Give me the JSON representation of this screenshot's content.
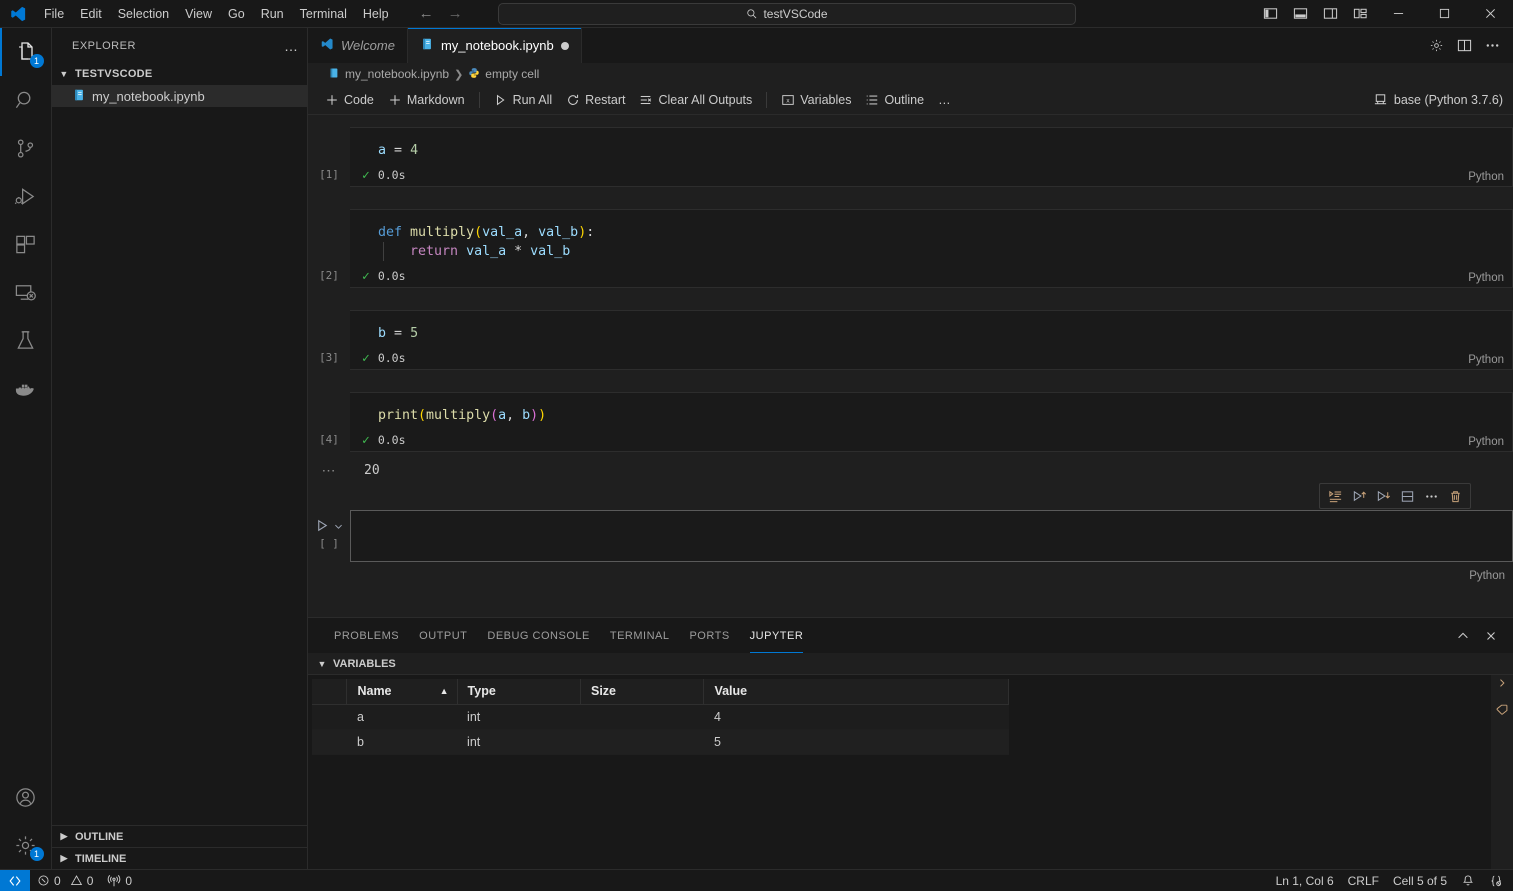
{
  "titlebar": {
    "menus": [
      "File",
      "Edit",
      "Selection",
      "View",
      "Go",
      "Run",
      "Terminal",
      "Help"
    ],
    "search_text": "testVSCode",
    "back_icon": "arrow-left-icon",
    "forward_icon": "arrow-right-icon",
    "layout_icons": [
      "toggle-primary-sidebar-icon",
      "toggle-panel-icon",
      "toggle-secondary-sidebar-icon",
      "customize-layout-icon"
    ],
    "window_controls": [
      "minimize",
      "maximize",
      "close"
    ]
  },
  "activitybar": {
    "items": [
      {
        "name": "explorer",
        "badge": "1",
        "active": true
      },
      {
        "name": "search",
        "badge": "",
        "active": false
      },
      {
        "name": "source-control",
        "badge": "",
        "active": false
      },
      {
        "name": "run-and-debug",
        "badge": "",
        "active": false
      },
      {
        "name": "extensions",
        "badge": "",
        "active": false
      },
      {
        "name": "remote-explorer",
        "badge": "",
        "active": false
      },
      {
        "name": "testing",
        "badge": "",
        "active": false
      },
      {
        "name": "docker",
        "badge": "",
        "active": false
      }
    ],
    "bottom": [
      {
        "name": "accounts",
        "badge": ""
      },
      {
        "name": "manage-settings",
        "badge": "1"
      }
    ]
  },
  "sidebar": {
    "title": "EXPLORER",
    "more_actions": "…",
    "folder": "TESTVSCODE",
    "files": [
      {
        "name": "my_notebook.ipynb"
      }
    ],
    "collapsed_sections": [
      "OUTLINE",
      "TIMELINE"
    ]
  },
  "tabs": [
    {
      "label": "Welcome",
      "icon": "vscode-logo-icon",
      "active": false,
      "dirty": false
    },
    {
      "label": "my_notebook.ipynb",
      "icon": "notebook-icon",
      "active": true,
      "dirty": true
    }
  ],
  "tab_actions": [
    "settings-gear-icon",
    "split-editor-icon",
    "more-actions-icon"
  ],
  "breadcrumbs": [
    {
      "label": "my_notebook.ipynb",
      "icon": "notebook-icon"
    },
    {
      "label": "empty cell",
      "icon": "python-cell-icon"
    }
  ],
  "notebook_toolbar": {
    "buttons": [
      {
        "label": "Code",
        "icon": "plus-icon"
      },
      {
        "label": "Markdown",
        "icon": "plus-icon"
      },
      {
        "label": "Run All",
        "icon": "run-all-icon"
      },
      {
        "label": "Restart",
        "icon": "restart-icon"
      },
      {
        "label": "Clear All Outputs",
        "icon": "clear-outputs-icon"
      },
      {
        "label": "Variables",
        "icon": "variables-icon"
      },
      {
        "label": "Outline",
        "icon": "outline-icon"
      }
    ],
    "more": "…",
    "kernel_label": "base (Python 3.7.6)",
    "kernel_icon": "kernel-icon"
  },
  "cells": [
    {
      "exec_count": "[1]",
      "status": "0.0s",
      "status_icon": "success-check-icon",
      "language": "Python",
      "lines": [
        [
          {
            "t": "a",
            "c": "t-var"
          },
          {
            "t": " ",
            "c": "t-plain"
          },
          {
            "t": "=",
            "c": "t-op"
          },
          {
            "t": " ",
            "c": "t-plain"
          },
          {
            "t": "4",
            "c": "t-num"
          }
        ]
      ]
    },
    {
      "exec_count": "[2]",
      "status": "0.0s",
      "status_icon": "success-check-icon",
      "language": "Python",
      "lines": [
        [
          {
            "t": "def",
            "c": "t-kw"
          },
          {
            "t": " ",
            "c": "t-plain"
          },
          {
            "t": "multiply",
            "c": "t-fn"
          },
          {
            "t": "(",
            "c": "t-par1"
          },
          {
            "t": "val_a",
            "c": "t-var"
          },
          {
            "t": ", ",
            "c": "t-plain"
          },
          {
            "t": "val_b",
            "c": "t-var"
          },
          {
            "t": ")",
            "c": "t-par1"
          },
          {
            "t": ":",
            "c": "t-plain"
          }
        ],
        [
          {
            "t": "    ",
            "c": "t-plain"
          },
          {
            "t": "return",
            "c": "t-kw2"
          },
          {
            "t": " ",
            "c": "t-plain"
          },
          {
            "t": "val_a",
            "c": "t-var"
          },
          {
            "t": " ",
            "c": "t-plain"
          },
          {
            "t": "*",
            "c": "t-op"
          },
          {
            "t": " ",
            "c": "t-plain"
          },
          {
            "t": "val_b",
            "c": "t-var"
          }
        ]
      ]
    },
    {
      "exec_count": "[3]",
      "status": "0.0s",
      "status_icon": "success-check-icon",
      "language": "Python",
      "lines": [
        [
          {
            "t": "b",
            "c": "t-var"
          },
          {
            "t": " ",
            "c": "t-plain"
          },
          {
            "t": "=",
            "c": "t-op"
          },
          {
            "t": " ",
            "c": "t-plain"
          },
          {
            "t": "5",
            "c": "t-num"
          }
        ]
      ]
    },
    {
      "exec_count": "[4]",
      "status": "0.0s",
      "status_icon": "success-check-icon",
      "language": "Python",
      "lines": [
        [
          {
            "t": "print",
            "c": "t-fn"
          },
          {
            "t": "(",
            "c": "t-par1"
          },
          {
            "t": "multiply",
            "c": "t-fn"
          },
          {
            "t": "(",
            "c": "t-par2"
          },
          {
            "t": "a",
            "c": "t-var"
          },
          {
            "t": ", ",
            "c": "t-plain"
          },
          {
            "t": "b",
            "c": "t-var"
          },
          {
            "t": ")",
            "c": "t-par2"
          },
          {
            "t": ")",
            "c": "t-par1"
          }
        ]
      ],
      "output": {
        "collapse_icon": "⋯",
        "text": "20"
      }
    }
  ],
  "empty_cell": {
    "exec_count": "[ ]",
    "language": "Python",
    "run_icon": "run-cell-icon",
    "chevron_icon": "chevron-down-icon",
    "toolbar_icons": [
      "execute-above-icon",
      "run-by-line-icon",
      "execute-below-icon",
      "split-cell-icon",
      "more-actions-icon",
      "delete-cell-icon"
    ]
  },
  "panel": {
    "tabs": [
      {
        "label": "PROBLEMS",
        "active": false
      },
      {
        "label": "OUTPUT",
        "active": false
      },
      {
        "label": "DEBUG CONSOLE",
        "active": false
      },
      {
        "label": "TERMINAL",
        "active": false
      },
      {
        "label": "PORTS",
        "active": false
      },
      {
        "label": "JUPYTER",
        "active": true
      }
    ],
    "actions": [
      "collapse-panel-icon",
      "close-panel-icon"
    ],
    "variables_section": "VARIABLES",
    "rail_icons": [
      "expand-rail-icon",
      "filter-variables-icon"
    ],
    "table": {
      "columns": [
        "",
        "Name",
        "Type",
        "Size",
        "Value"
      ],
      "sorted_column": "Name",
      "sort_direction": "▲",
      "rows": [
        {
          "index": "",
          "name": "a",
          "type": "int",
          "size": "",
          "value": "4"
        },
        {
          "index": "",
          "name": "b",
          "type": "int",
          "size": "",
          "value": "5"
        }
      ]
    }
  },
  "statusbar": {
    "remote_icon": "remote-window-icon",
    "errors": "0",
    "warnings": "0",
    "ports": "0",
    "right_items": [
      "Ln 1, Col 6",
      "CRLF",
      "Cell 5 of 5"
    ],
    "bell_icon": "notifications-bell-icon",
    "brackets_icon": "bracket-pair-icon"
  },
  "colors": {
    "accent": "#0078d4",
    "success": "#3fb950",
    "bg": "#1f1f1f",
    "bg_dark": "#181818",
    "cell_bg": "#1a1a1a"
  }
}
